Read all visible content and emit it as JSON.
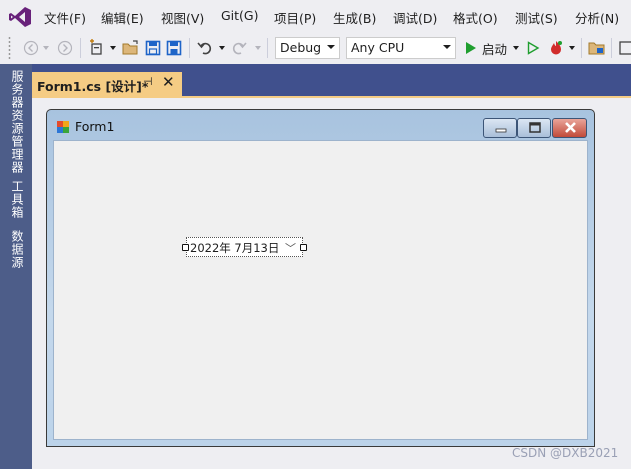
{
  "menu": {
    "items": [
      "文件(F)",
      "编辑(E)",
      "视图(V)",
      "Git(G)",
      "项目(P)",
      "生成(B)",
      "调试(D)",
      "格式(O)",
      "测试(S)",
      "分析(N)"
    ]
  },
  "toolbar": {
    "configuration": "Debug",
    "platform": "Any CPU",
    "start_label": "启动"
  },
  "left_dock": {
    "tabs": [
      "服务器资源管理器",
      "工具箱",
      "数据源"
    ]
  },
  "document_tab": {
    "title": "Form1.cs [设计]*"
  },
  "form": {
    "title": "Form1",
    "date_picker_value": "2022年  7月13日"
  },
  "watermark": "CSDN @DXB2021",
  "colors": {
    "dock_background": "#4d5d89",
    "editor_background": "#40508d",
    "active_tab": "#f5cc84",
    "vs_purple": "#68217a",
    "play_green": "#1f9e2f"
  }
}
